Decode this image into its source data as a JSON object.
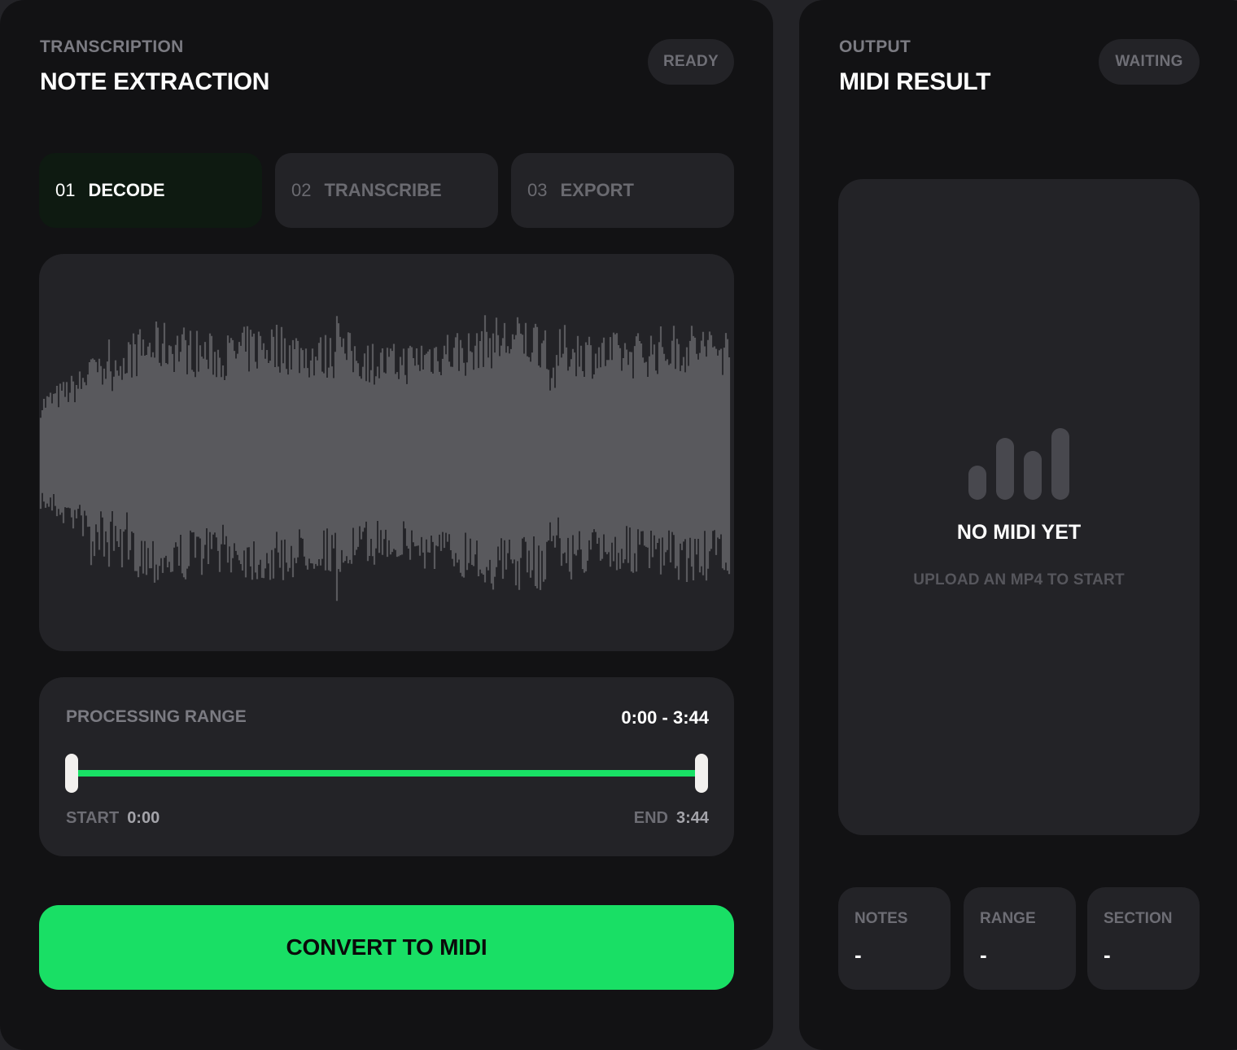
{
  "transcription": {
    "eyebrow": "TRANSCRIPTION",
    "title": "NOTE EXTRACTION",
    "status": "READY",
    "steps": [
      {
        "num": "01",
        "label": "DECODE",
        "active": true
      },
      {
        "num": "02",
        "label": "TRANSCRIBE",
        "active": false
      },
      {
        "num": "03",
        "label": "EXPORT",
        "active": false
      }
    ],
    "waveform": {
      "color": "#59595d"
    },
    "range": {
      "title": "PROCESSING RANGE",
      "value": "0:00 - 3:44",
      "start_label": "START",
      "start_value": "0:00",
      "end_label": "END",
      "end_value": "3:44",
      "fill_fraction": 1.0
    },
    "convert_label": "CONVERT TO MIDI"
  },
  "output": {
    "eyebrow": "OUTPUT",
    "title": "MIDI RESULT",
    "status": "WAITING",
    "empty_title": "NO MIDI YET",
    "empty_subtitle": "UPLOAD AN MP4 TO START",
    "empty_icon": "midi-bars-icon",
    "stats": [
      {
        "label": "NOTES",
        "value": "-"
      },
      {
        "label": "RANGE",
        "value": "-"
      },
      {
        "label": "SECTION",
        "value": "-"
      }
    ]
  },
  "colors": {
    "accent": "#19df65",
    "panel": "#121214",
    "card": "#232327"
  }
}
